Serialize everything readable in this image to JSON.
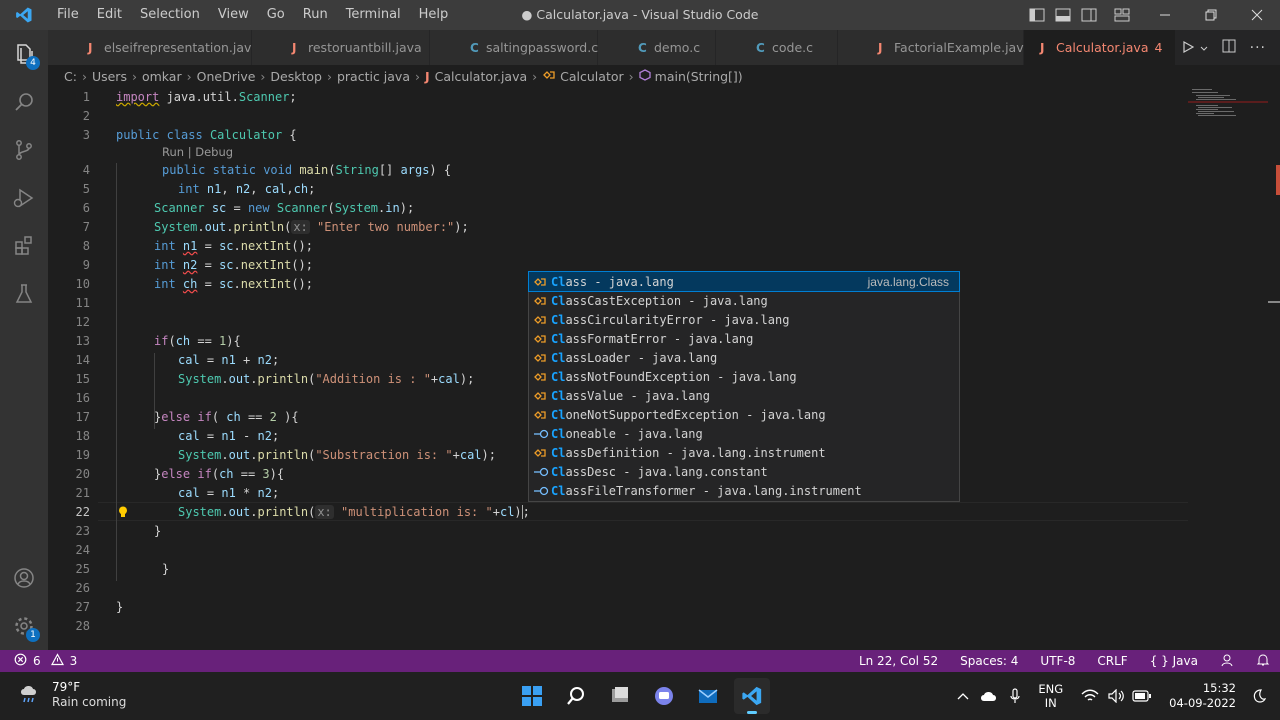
{
  "window": {
    "title": "● Calculator.java - Visual Studio Code",
    "menu": [
      "File",
      "Edit",
      "Selection",
      "View",
      "Go",
      "Run",
      "Terminal",
      "Help"
    ]
  },
  "activity": {
    "explorer_badge": "4",
    "accounts_badge": "1"
  },
  "tabs": [
    {
      "icon": "J",
      "label": "elseifrepresentation.java",
      "color": "#f48771"
    },
    {
      "icon": "J",
      "label": "restoruantbill.java",
      "color": "#f48771"
    },
    {
      "icon": "C",
      "label": "saltingpassword.c",
      "color": "#519aba"
    },
    {
      "icon": "C",
      "label": "demo.c",
      "color": "#519aba"
    },
    {
      "icon": "C",
      "label": "code.c",
      "color": "#519aba"
    },
    {
      "icon": "J",
      "label": "FactorialExample.java",
      "color": "#f48771"
    },
    {
      "icon": "J",
      "label": "Calculator.java",
      "count": "4",
      "color": "#f48771"
    }
  ],
  "breadcrumb": {
    "items": [
      "C:",
      "Users",
      "omkar",
      "OneDrive",
      "Desktop",
      "practic java",
      "Calculator.java",
      "Calculator",
      "main(String[])"
    ]
  },
  "editor": {
    "codelens": "Run | Debug",
    "current_line": "22",
    "line_numbers": [
      "1",
      "2",
      "3",
      "4",
      "5",
      "6",
      "7",
      "8",
      "9",
      "10",
      "11",
      "12",
      "13",
      "14",
      "15",
      "16",
      "17",
      "18",
      "19",
      "20",
      "21",
      "22",
      "23",
      "24",
      "25",
      "26",
      "27",
      "28"
    ]
  },
  "suggest": {
    "items": [
      {
        "match": "Cl",
        "rest": "ass - java.lang",
        "detail": "java.lang.Class",
        "kind": "class"
      },
      {
        "match": "Cl",
        "rest": "assCastException - java.lang",
        "kind": "class"
      },
      {
        "match": "Cl",
        "rest": "assCircularityError - java.lang",
        "kind": "class"
      },
      {
        "match": "Cl",
        "rest": "assFormatError - java.lang",
        "kind": "class"
      },
      {
        "match": "Cl",
        "rest": "assLoader - java.lang",
        "kind": "class"
      },
      {
        "match": "Cl",
        "rest": "assNotFoundException - java.lang",
        "kind": "class"
      },
      {
        "match": "Cl",
        "rest": "assValue - java.lang",
        "kind": "class"
      },
      {
        "match": "Cl",
        "rest": "oneNotSupportedException - java.lang",
        "kind": "class"
      },
      {
        "match": "Cl",
        "rest": "oneable - java.lang",
        "kind": "interface"
      },
      {
        "match": "Cl",
        "rest": "assDefinition - java.lang.instrument",
        "kind": "class"
      },
      {
        "match": "Cl",
        "rest": "assDesc - java.lang.constant",
        "kind": "interface"
      },
      {
        "match": "Cl",
        "rest": "assFileTransformer - java.lang.instrument",
        "kind": "interface"
      }
    ]
  },
  "status": {
    "errors": "6",
    "warnings": "3",
    "position": "Ln 22, Col 52",
    "spaces": "Spaces: 4",
    "encoding": "UTF-8",
    "eol": "CRLF",
    "language": "Java",
    "language_icon": "{ }"
  },
  "taskbar": {
    "temp": "79°F",
    "weather": "Rain coming",
    "lang_top": "ENG",
    "lang_bottom": "IN",
    "time": "15:32",
    "date": "04-09-2022"
  },
  "colors": {
    "statusbar": "#68217a",
    "accent": "#007acc",
    "editor_bg": "#1e1e1e"
  }
}
